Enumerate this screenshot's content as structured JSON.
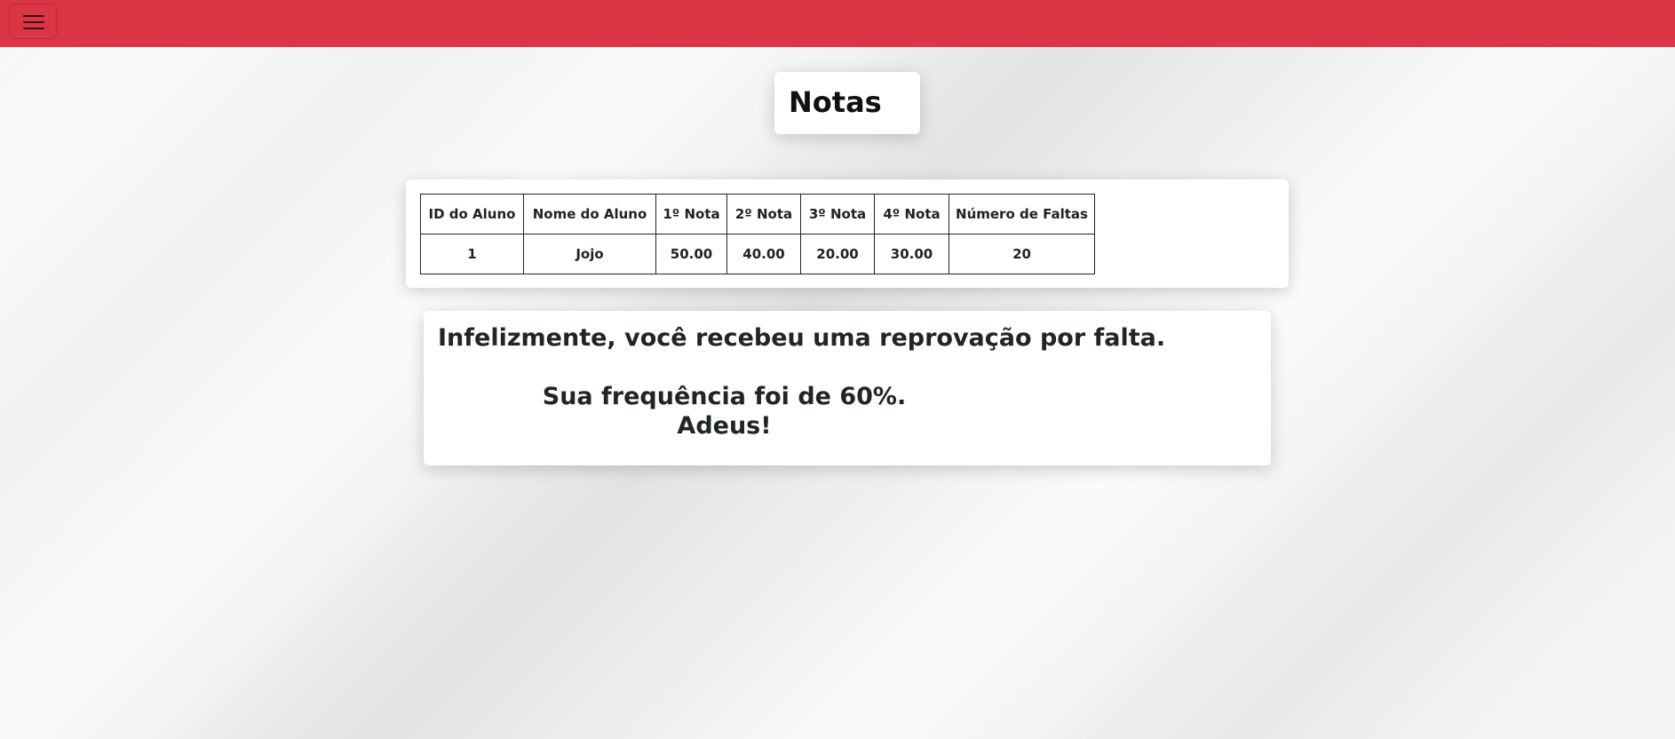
{
  "navbar": {
    "menu_icon": "hamburger-menu-icon",
    "color": "#dc3545"
  },
  "page": {
    "title": "Notas"
  },
  "table": {
    "headers": [
      "ID do Aluno",
      "Nome do Aluno",
      "1º Nota",
      "2º Nota",
      "3º Nota",
      "4º Nota",
      "Número de Faltas"
    ],
    "rows": [
      [
        "1",
        "Jojo",
        "50.00",
        "40.00",
        "20.00",
        "30.00",
        "20"
      ]
    ]
  },
  "message": {
    "line1": "Infelizmente, você recebeu uma reprovação por falta.",
    "line2": "Sua frequência foi de 60%.",
    "line3": "Adeus!"
  }
}
